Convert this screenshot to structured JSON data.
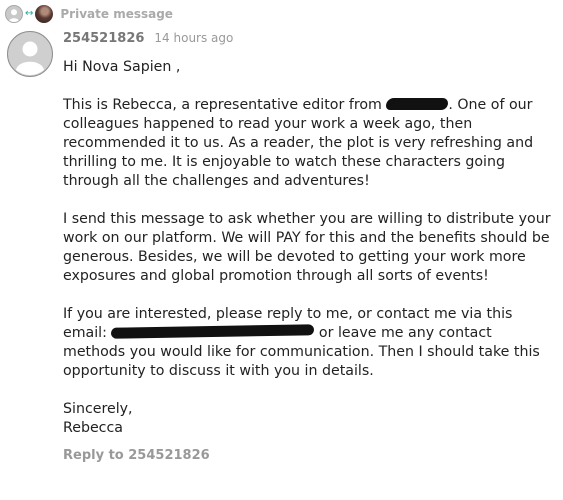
{
  "header": {
    "label": "Private message",
    "avatar_icons": [
      "default-avatar-icon",
      "swap-arrows-icon",
      "user-photo-avatar"
    ]
  },
  "message": {
    "sender": "254521826",
    "time": "14 hours ago",
    "greeting": "Hi Nova Sapien ,",
    "p1_before_redaction": "This is Rebecca, a representative editor from ",
    "p1_after_redaction": ". One of our colleagues happened to read your work a week ago, then recommended it to us. As a reader, the plot is very refreshing and thrilling to me. It is enjoyable to watch these characters going through all the challenges and adventures!",
    "p2": "I send this message to ask whether you are willing to distribute your work on our platform. We will PAY for this and the benefits should be generous. Besides, we will be devoted to getting your work more exposures and global promotion through all sorts of events!",
    "p3_before_email": "If you are interested, please reply to me, or contact me via this email: ",
    "p3_after_email": " or leave me any contact methods you would like for communication. Then I should take this opportunity to discuss it with you in details.",
    "signoff": "Sincerely,",
    "signature": "Rebecca"
  },
  "actions": {
    "reply_label": "Reply to 254521826"
  },
  "colors": {
    "muted_text": "#999999",
    "username": "#777777",
    "body_text": "#222222",
    "arrow_accent": "#2aa7a0",
    "redaction": "#111111"
  }
}
